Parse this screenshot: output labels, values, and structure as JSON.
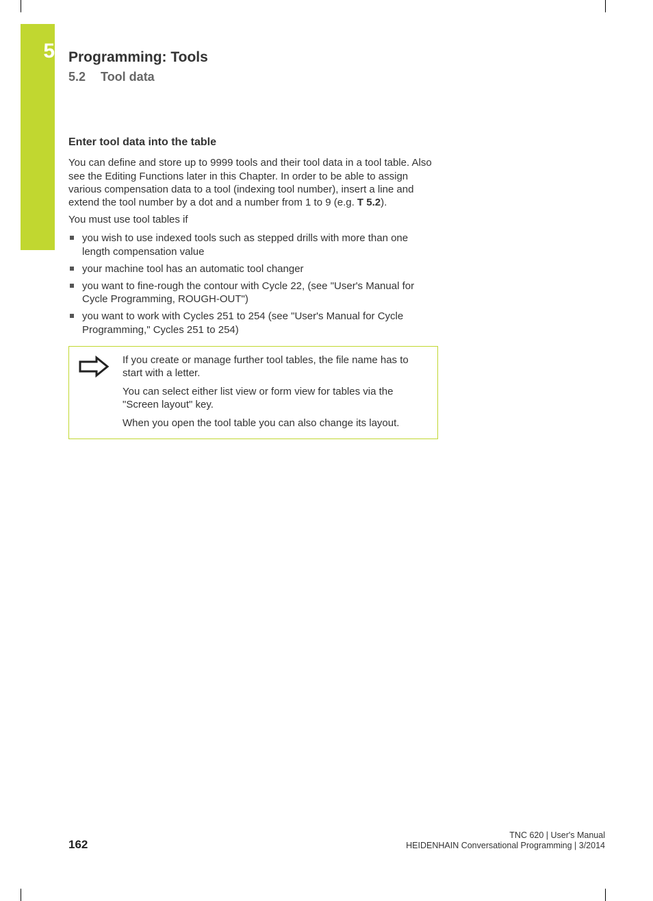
{
  "chapter": {
    "number": "5",
    "title": "Programming: Tools",
    "section_number": "5.2",
    "section_title": "Tool data"
  },
  "subheading": "Enter tool data into the table",
  "intro_para_pre": "You can define and store up to 9999 tools and their tool data in a tool table. Also see the Editing Functions later in this Chapter. In order to be able to assign various compensation data to a tool (indexing tool number), insert a line and extend the tool number by a dot and a number from 1 to 9 (e.g. ",
  "intro_para_bold": "T 5.2",
  "intro_para_post": ").",
  "intro2": "You must use tool tables if",
  "bullets": [
    "you wish to use indexed tools such as stepped drills with more than one length compensation value",
    "your machine tool has an automatic tool changer",
    "you want to fine-rough the contour with Cycle 22, (see \"User's Manual for Cycle Programming, ROUGH-OUT\")",
    "you want to work with Cycles 251 to 254 (see \"User's Manual for Cycle Programming,\" Cycles 251 to 254)"
  ],
  "note": {
    "p1": "If you create or manage further tool tables, the file name has to start with a letter.",
    "p2": "You can select either list view or form view for tables via the \"Screen layout\" key.",
    "p3": "When you open the tool table you can also change its layout."
  },
  "footer": {
    "page": "162",
    "line1": "TNC 620 | User's Manual",
    "line2": "HEIDENHAIN Conversational Programming | 3/2014"
  }
}
